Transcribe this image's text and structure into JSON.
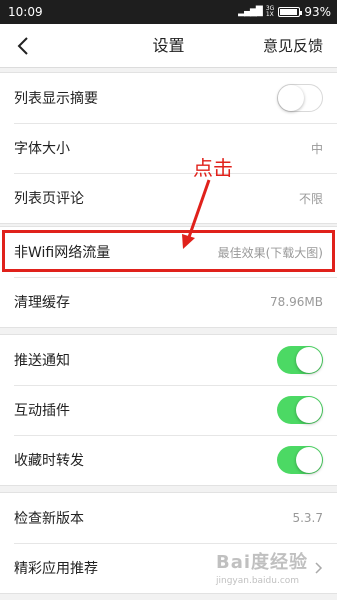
{
  "status_bar": {
    "time": "10:09",
    "network_top": "3G",
    "network_bottom": "1X",
    "battery_percent": "93%",
    "battery_level": 0.93
  },
  "nav": {
    "title": "设置",
    "feedback": "意见反馈"
  },
  "group1": {
    "summary_label": "列表显示摘要",
    "summary_toggle_on": false,
    "font_size_label": "字体大小",
    "font_size_value": "中",
    "comment_label": "列表页评论",
    "comment_value": "不限"
  },
  "group2": {
    "wifi_label": "非Wifi网络流量",
    "wifi_value": "最佳效果(下载大图)",
    "cache_label": "清理缓存",
    "cache_value": "78.96MB"
  },
  "group3": {
    "push_label": "推送通知",
    "push_on": true,
    "plugin_label": "互动插件",
    "plugin_on": true,
    "favorite_label": "收藏时转发",
    "favorite_on": true
  },
  "group4": {
    "update_label": "检查新版本",
    "update_value": "5.3.7",
    "recommend_label": "精彩应用推荐"
  },
  "annotation": {
    "text": "点击",
    "color": "#e0211b"
  },
  "watermark": {
    "logo": "Bai度经验",
    "url": "jingyan.baidu.com"
  },
  "colors": {
    "toggle_on": "#4cd964",
    "accent_red": "#e0211b"
  }
}
